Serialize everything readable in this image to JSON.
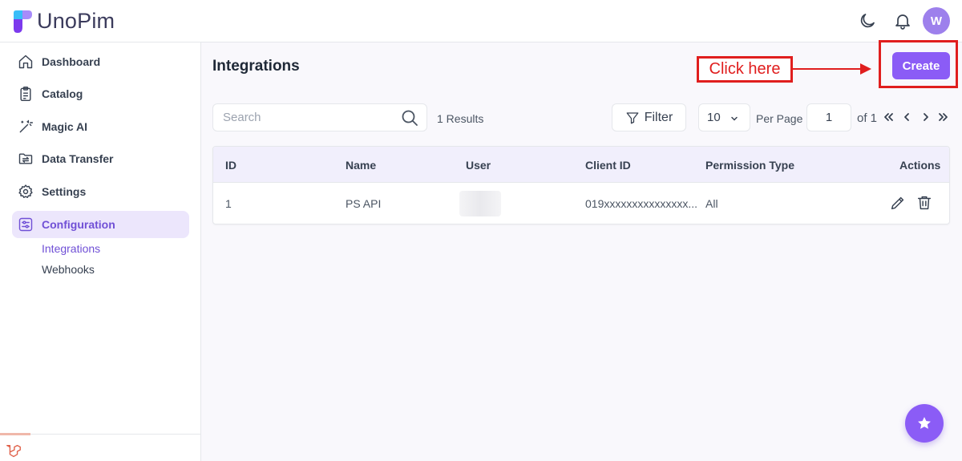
{
  "app": {
    "name": "UnoPim",
    "user_initial": "W"
  },
  "colors": {
    "accent": "#8b5cf6",
    "accent_text": "#7050d6",
    "active_bg": "#ece6fc",
    "annotation": "#e01e1e"
  },
  "sidebar": {
    "items": [
      {
        "label": "Dashboard",
        "icon": "home-icon"
      },
      {
        "label": "Catalog",
        "icon": "clipboard-icon"
      },
      {
        "label": "Magic AI",
        "icon": "magic-wand-icon"
      },
      {
        "label": "Data Transfer",
        "icon": "folder-transfer-icon"
      },
      {
        "label": "Settings",
        "icon": "gear-icon"
      },
      {
        "label": "Configuration",
        "icon": "sliders-icon",
        "active": true
      }
    ],
    "sub_items": [
      {
        "label": "Integrations",
        "active": true
      },
      {
        "label": "Webhooks"
      }
    ]
  },
  "main": {
    "title": "Integrations",
    "create_label": "Create",
    "annotation_text": "Click here",
    "search_placeholder": "Search",
    "results": "1 Results",
    "filter_label": "Filter",
    "per_page_value": "10",
    "per_page_label": "Per Page",
    "page_value": "1",
    "of_label": "of 1"
  },
  "table": {
    "columns": [
      "ID",
      "Name",
      "User",
      "Client ID",
      "Permission Type",
      "Actions"
    ],
    "rows": [
      {
        "id": "1",
        "name": "PS API",
        "user": "",
        "client_id": "019xxxxxxxxxxxxxxx...",
        "permission": "All"
      }
    ]
  }
}
